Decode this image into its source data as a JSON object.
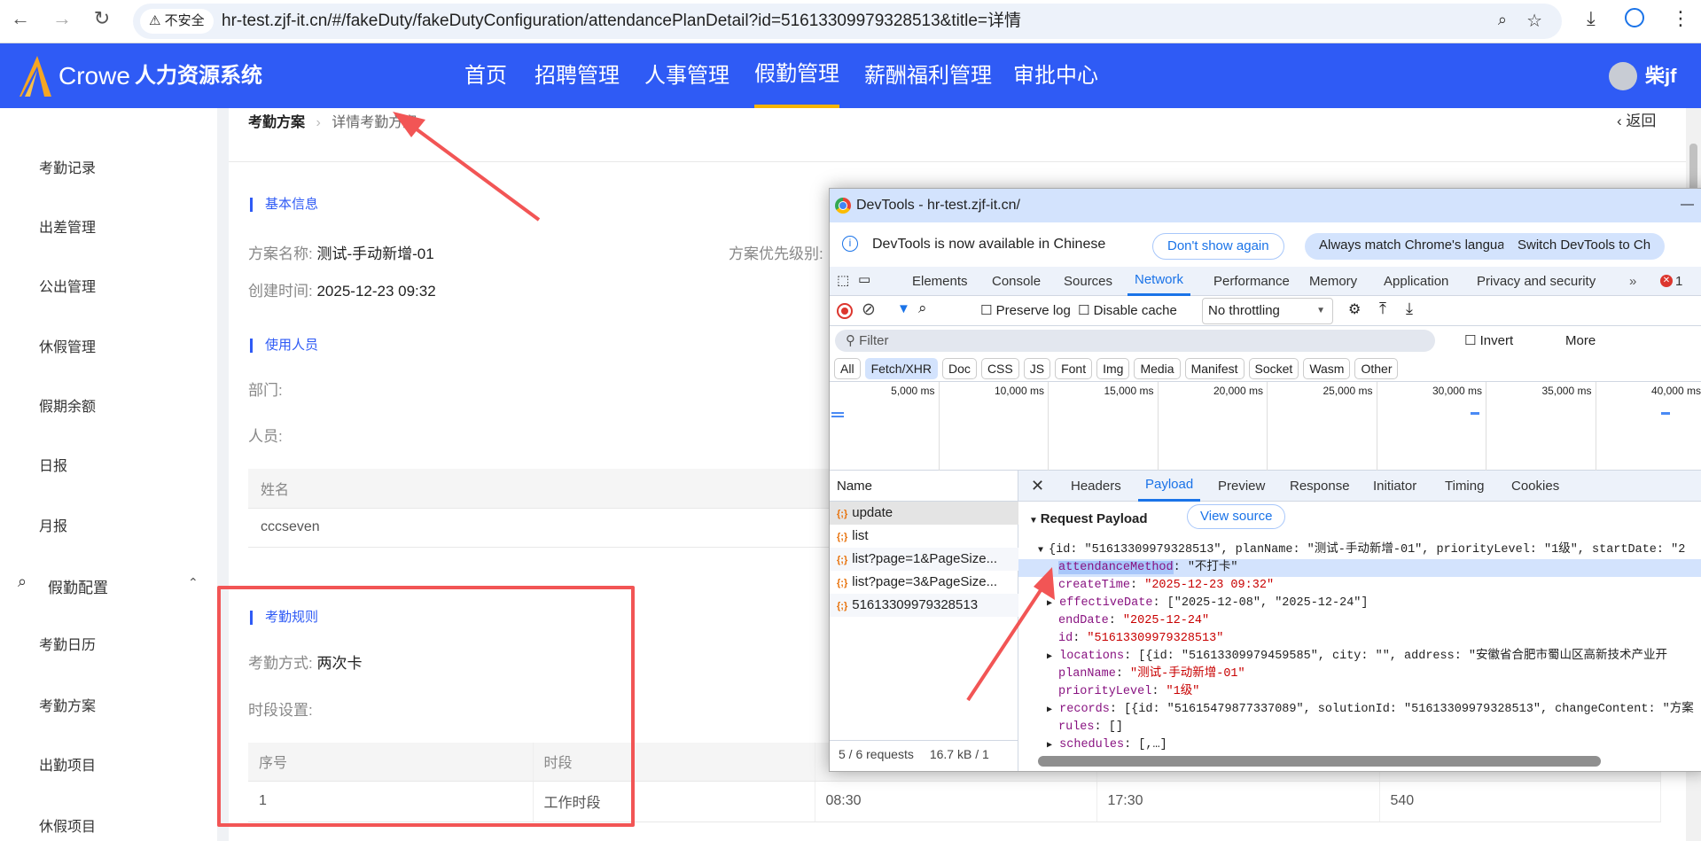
{
  "browser": {
    "security_label": "不安全",
    "url": "hr-test.zjf-it.cn/#/fakeDuty/fakeDutyConfiguration/attendancePlanDetail?id=51613309979328513&title=详情"
  },
  "header": {
    "brand": "Crowe",
    "system_name": "人力资源系统",
    "nav": [
      "首页",
      "招聘管理",
      "人事管理",
      "假勤管理",
      "薪酬福利管理",
      "审批中心"
    ],
    "active_nav": "假勤管理",
    "user": "柴jf",
    "accent": "#2f5bf5"
  },
  "sidebar": {
    "items": [
      "考勤记录",
      "出差管理",
      "公出管理",
      "休假管理",
      "假期余额",
      "日报",
      "月报"
    ],
    "section": "假勤配置",
    "sub_items": [
      "考勤日历",
      "考勤方案",
      "出勤项目",
      "休假项目"
    ]
  },
  "breadcrumb": {
    "parent": "考勤方案",
    "current": "详情考勤方案",
    "back": "返回"
  },
  "basic": {
    "title": "基本信息",
    "name_label": "方案名称:",
    "name_value": "测试-手动新增-01",
    "priority_label": "方案优先级别:",
    "created_label": "创建时间:",
    "created_value": "2025-12-23 09:32"
  },
  "users": {
    "title": "使用人员",
    "dept_label": "部门:",
    "person_label": "人员:",
    "table_header": "姓名",
    "rows": [
      "cccseven"
    ]
  },
  "rules": {
    "title": "考勤规则",
    "method_label": "考勤方式:",
    "method_value": "两次卡",
    "period_label": "时段设置:",
    "headers": [
      "序号",
      "时段"
    ],
    "rows": [
      [
        "1",
        "工作时段",
        "08:30",
        "17:30",
        "540"
      ]
    ]
  },
  "devtools": {
    "title": "DevTools - hr-test.zjf-it.cn/",
    "info": "DevTools is now available in Chinese",
    "btn_dont_show": "Don't show again",
    "btn_match": "Always match Chrome's language",
    "btn_switch": "Switch DevTools to Ch",
    "tabs": [
      "Elements",
      "Console",
      "Sources",
      "Network",
      "Performance",
      "Memory",
      "Application",
      "Privacy and security"
    ],
    "more": "»",
    "error_count": "1",
    "preserve_log": "Preserve log",
    "disable_cache": "Disable cache",
    "throttling": "No throttling",
    "filter_placeholder": "Filter",
    "invert": "Invert",
    "more_filters": "More",
    "types": [
      "All",
      "Fetch/XHR",
      "Doc",
      "CSS",
      "JS",
      "Font",
      "Img",
      "Media",
      "Manifest",
      "Socket",
      "Wasm",
      "Other"
    ],
    "ticks": [
      "5,000 ms",
      "10,000 ms",
      "15,000 ms",
      "20,000 ms",
      "25,000 ms",
      "30,000 ms",
      "35,000 ms",
      "40,000 ms"
    ],
    "name_header": "Name",
    "requests": [
      "update",
      "list",
      "list?page=1&PageSize...",
      "list?page=3&PageSize...",
      "51613309979328513"
    ],
    "footer_requests": "5 / 6 requests",
    "footer_size": "16.7 kB / 1",
    "detail_tabs": [
      "Headers",
      "Payload",
      "Preview",
      "Response",
      "Initiator",
      "Timing",
      "Cookies"
    ],
    "payload_title": "Request Payload",
    "view_source": "View source",
    "payload": {
      "root": "{id: \"51613309979328513\", planName: \"测试-手动新增-01\", priorityLevel: \"1级\", startDate: \"2",
      "lines": [
        {
          "arrow": "",
          "key": "attendanceMethod",
          "value": "\"不打卡\""
        },
        {
          "arrow": "",
          "key": "createTime",
          "value": "\"2025-12-23 09:32\""
        },
        {
          "arrow": "▶",
          "key": "effectiveDate",
          "value": "[\"2025-12-08\", \"2025-12-24\"]"
        },
        {
          "arrow": "",
          "key": "endDate",
          "value": "\"2025-12-24\""
        },
        {
          "arrow": "",
          "key": "id",
          "value": "\"51613309979328513\""
        },
        {
          "arrow": "▶",
          "key": "locations",
          "value": "[{id: \"51613309979459585\", city: \"\", address: \"安徽省合肥市蜀山区高新技术产业开"
        },
        {
          "arrow": "",
          "key": "planName",
          "value": "\"测试-手动新增-01\""
        },
        {
          "arrow": "",
          "key": "priorityLevel",
          "value": "\"1级\""
        },
        {
          "arrow": "▶",
          "key": "records",
          "value": "[{id: \"51615479877337089\", solutionId: \"51613309979328513\", changeContent: \"方案"
        },
        {
          "arrow": "",
          "key": "rules",
          "value": "[]"
        },
        {
          "arrow": "▶",
          "key": "schedules",
          "value": "[,…]"
        }
      ]
    }
  }
}
